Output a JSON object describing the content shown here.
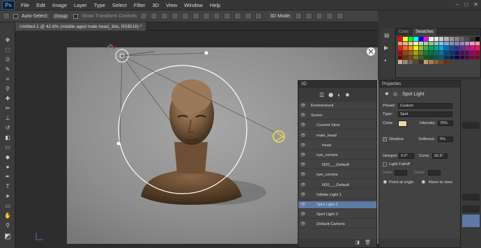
{
  "app": {
    "logo": "Ps"
  },
  "menu": [
    "File",
    "Edit",
    "Image",
    "Layer",
    "Type",
    "Select",
    "Filter",
    "3D",
    "View",
    "Window",
    "Help"
  ],
  "options_bar": {
    "auto_select": "Auto-Select:",
    "group_value": "Group",
    "show_transform": "Show Transform Controls",
    "mode_label": "3D Mode:",
    "workspace": "3D"
  },
  "document": {
    "tab_title": "Untitled-1 @ 42.6% (middle aged male head_3ds, RGB/16) *"
  },
  "panel_3d": {
    "tab": "3D",
    "rows": [
      {
        "label": "Environment",
        "indent": 1
      },
      {
        "label": "Scene",
        "indent": 1
      },
      {
        "label": "Current View",
        "indent": 2
      },
      {
        "label": "male_head",
        "indent": 2
      },
      {
        "label": "head",
        "indent": 3
      },
      {
        "label": "eye_cornea",
        "indent": 2
      },
      {
        "label": "N20___Default",
        "indent": 3
      },
      {
        "label": "eye_cornea",
        "indent": 2
      },
      {
        "label": "N20___Default",
        "indent": 3
      },
      {
        "label": "Infinite Light 1",
        "indent": 2
      },
      {
        "label": "Spot Light 1",
        "indent": 2,
        "selected": true
      },
      {
        "label": "Spot Light 2",
        "indent": 2
      },
      {
        "label": "Default Camera",
        "indent": 2
      }
    ]
  },
  "properties": {
    "tab": "Properties",
    "title": "Spot Light",
    "preset_label": "Preset:",
    "preset_value": "Custom",
    "type_label": "Type:",
    "type_value": "Spot",
    "color_label": "Color:",
    "color_hex": "#f6d5a4",
    "intensity_label": "Intensity:",
    "intensity_value": "70%",
    "shadow_label": "Shadow",
    "softness_label": "Softness:",
    "softness_value": "0%",
    "hotspot_label": "Hotspot:",
    "hotspot_value": "9.5°",
    "cone_label": "Cone:",
    "cone_value": "50.5°",
    "falloff_label": "Light Falloff",
    "inner_label": "Inner:",
    "outer_label": "Outer:",
    "point_origin": "Point at origin",
    "move_view": "Move to view"
  },
  "swatches": {
    "tabs": [
      "Color",
      "Swatches"
    ],
    "colors": [
      "#ff0000",
      "#ffff00",
      "#00ff00",
      "#00ffff",
      "#0000ff",
      "#ff00ff",
      "#ffffff",
      "#e6e6e6",
      "#cccccc",
      "#b3b3b3",
      "#999999",
      "#808080",
      "#666666",
      "#4d4d4d",
      "#333333",
      "#000000",
      "#f7977a",
      "#f9ad81",
      "#fdc68a",
      "#fff79a",
      "#c4df9b",
      "#a2d39c",
      "#82ca9d",
      "#7bcdc8",
      "#6ecff6",
      "#7ea7d8",
      "#8493ca",
      "#8882be",
      "#a187be",
      "#bc8dbf",
      "#f49ac2",
      "#f6989d",
      "#ed1c24",
      "#f26522",
      "#f7941d",
      "#fff200",
      "#8dc63f",
      "#39b54a",
      "#00a651",
      "#00a99d",
      "#00aeef",
      "#0072bc",
      "#0054a6",
      "#2e3192",
      "#662d91",
      "#92278f",
      "#ec008c",
      "#ed145b",
      "#9e0b0f",
      "#a0410d",
      "#a36209",
      "#aba000",
      "#598527",
      "#197b30",
      "#007236",
      "#00746b",
      "#0076a3",
      "#004b80",
      "#003471",
      "#1b1464",
      "#440e62",
      "#630460",
      "#9e005d",
      "#9e0039",
      "#790000",
      "#7b2e00",
      "#7d4900",
      "#827b00",
      "#406618",
      "#005e20",
      "#005826",
      "#005952",
      "#005b7f",
      "#003663",
      "#002157",
      "#0d004c",
      "#32004b",
      "#4b0049",
      "#7b0046",
      "#7a0026",
      "#c7b299",
      "#998675",
      "#736357",
      "#534741",
      "#37302d",
      "#c69c6d",
      "#a67c52",
      "#8c6239",
      "#754c24",
      "#603913"
    ]
  }
}
